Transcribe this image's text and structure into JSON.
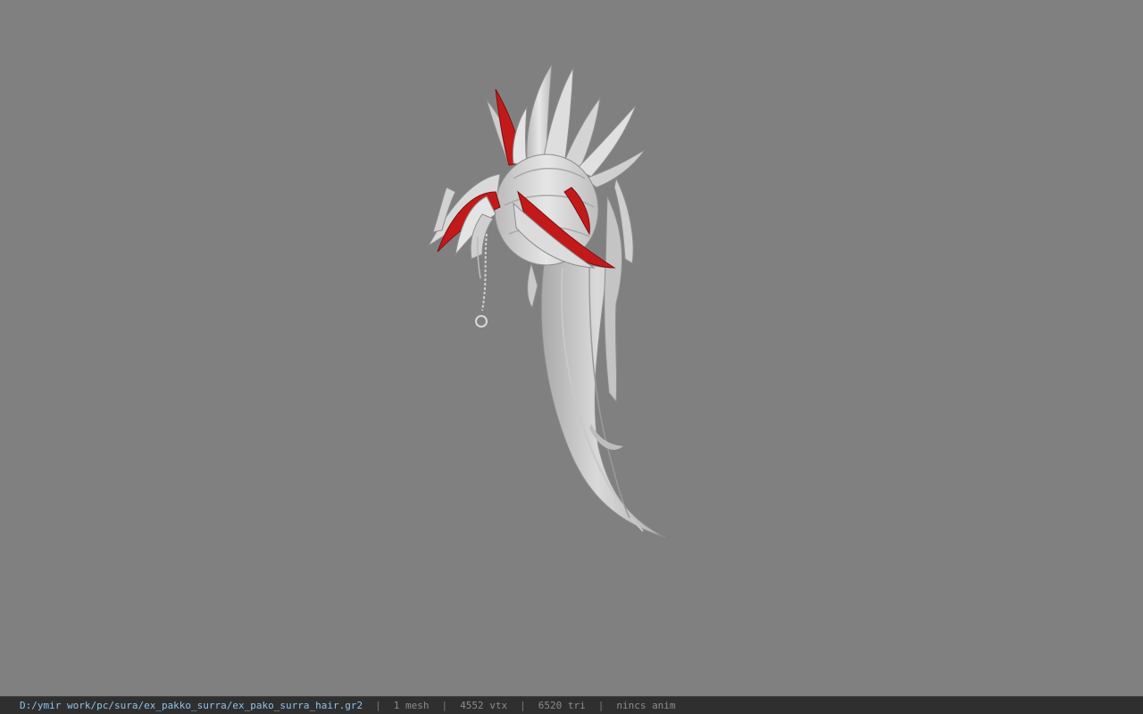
{
  "viewport": {
    "background_color": "#808080",
    "model": {
      "description_icon": "hair-model",
      "primary_color": "#d6d6d6",
      "accent_color": "#c21a1a"
    }
  },
  "status_bar": {
    "path": "D:/ymir work/pc/sura/ex_pakko_surra/ex_pako_surra_hair.gr2",
    "separator": "|",
    "mesh": "1 mesh",
    "vertices": "4552 vtx",
    "triangles": "6520 tri",
    "anim": "nincs anim",
    "path_color": "#8fc3e6",
    "background_color": "#2f2f2f"
  }
}
